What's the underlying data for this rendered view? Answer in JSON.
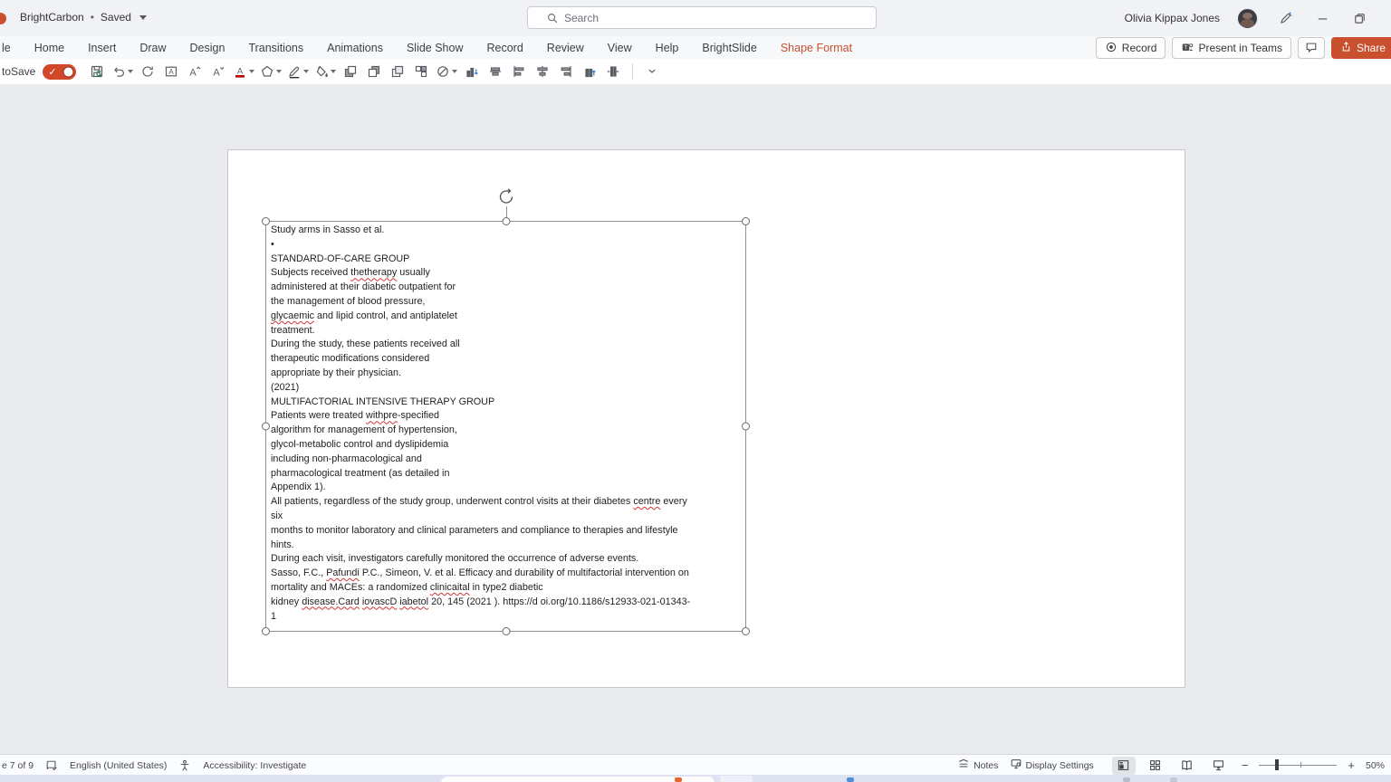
{
  "app": {
    "doc_name": "BrightCarbon",
    "saved_separator": "•",
    "saved_status": "Saved",
    "user_name": "Olivia Kippax Jones",
    "search_placeholder": "Search"
  },
  "menu_bar": {
    "items": [
      "le",
      "Home",
      "Insert",
      "Draw",
      "Design",
      "Transitions",
      "Animations",
      "Slide Show",
      "Record",
      "Review",
      "View",
      "Help",
      "BrightSlide",
      "Shape Format"
    ],
    "active_item": "Shape Format",
    "record_label": "Record",
    "present_label": "Present in Teams",
    "share_label": "Share"
  },
  "ribbon": {
    "autosave_label": "toSave",
    "icons": [
      "save-icon",
      "undo-icon",
      "redo-icon",
      "textbox-icon",
      "increase-font-icon",
      "decrease-font-icon",
      "font-color-icon",
      "shape-outline-icon",
      "draw-pen-icon",
      "fill-color-icon",
      "bring-forward-icon",
      "send-backward-icon",
      "bring-to-front-icon",
      "group-objects-icon",
      "no-fill-icon",
      "align-bottom-icon",
      "align-middle-icon",
      "align-left-icon",
      "align-center-icon",
      "align-right-icon",
      "align-top-icon",
      "distribute-horizontal-icon",
      "separator",
      "ribbon-collapse-icon"
    ],
    "dropdown_icons": [
      "undo-icon",
      "font-color-icon",
      "shape-outline-icon",
      "draw-pen-icon",
      "fill-color-icon",
      "no-fill-icon"
    ]
  },
  "slide": {
    "textbox": {
      "lines": [
        "Study arms in Sasso et al.",
        "•",
        "STANDARD-OF-CARE GROUP",
        "Subjects received thetherapy usually",
        "administered at their diabetic outpatient for",
        "the management of blood pressure,",
        "glycaemic and lipid control, and antiplatelet",
        "treatment.",
        "During the study, these patients received all",
        "therapeutic modifications considered",
        "appropriate by their physician.",
        "(2021)",
        "MULTIFACTORIAL INTENSIVE THERAPY GROUP",
        "Patients were treated withpre-specified",
        "algorithm for management of hypertension,",
        "glycol-metabolic control and dyslipidemia",
        "including non-pharmacological and",
        "pharmacological treatment (as detailed in",
        "Appendix 1).",
        "All patients, regardless of the study group, underwent control visits at their diabetes centre every",
        "six",
        "months to monitor laboratory and clinical parameters and compliance to therapies and lifestyle",
        "hints.",
        "During each visit, investigators carefully monitored the occurrence of adverse events.",
        "Sasso, F.C., Pafundi P.C., Simeon, V. et al. Efficacy and durability of multifactorial intervention on",
        "mortality and MACEs: a randomized clinicaital in type2 diabetic",
        "kidney disease.Card iovascD iabetol 20, 145 (2021 ). https://d oi.org/10.1186/s12933-021-01343-",
        "1"
      ],
      "misspelled": [
        "thetherapy",
        "glycaemic",
        "withpre",
        "centre",
        "Pafundi",
        "clinicaital",
        "disease.Card",
        "iovascD",
        "iabetol"
      ]
    }
  },
  "status_bar": {
    "slide_indicator": "e 7 of 9",
    "language": "English (United States)",
    "accessibility_label": "Accessibility: Investigate",
    "notes_label": "Notes",
    "display_settings_label": "Display Settings",
    "zoom_level": "50%"
  },
  "colors": {
    "accent_orange": "#c8502e",
    "spell_underline_red": "#d13438",
    "autosave_toggle_red": "#d0472a"
  }
}
